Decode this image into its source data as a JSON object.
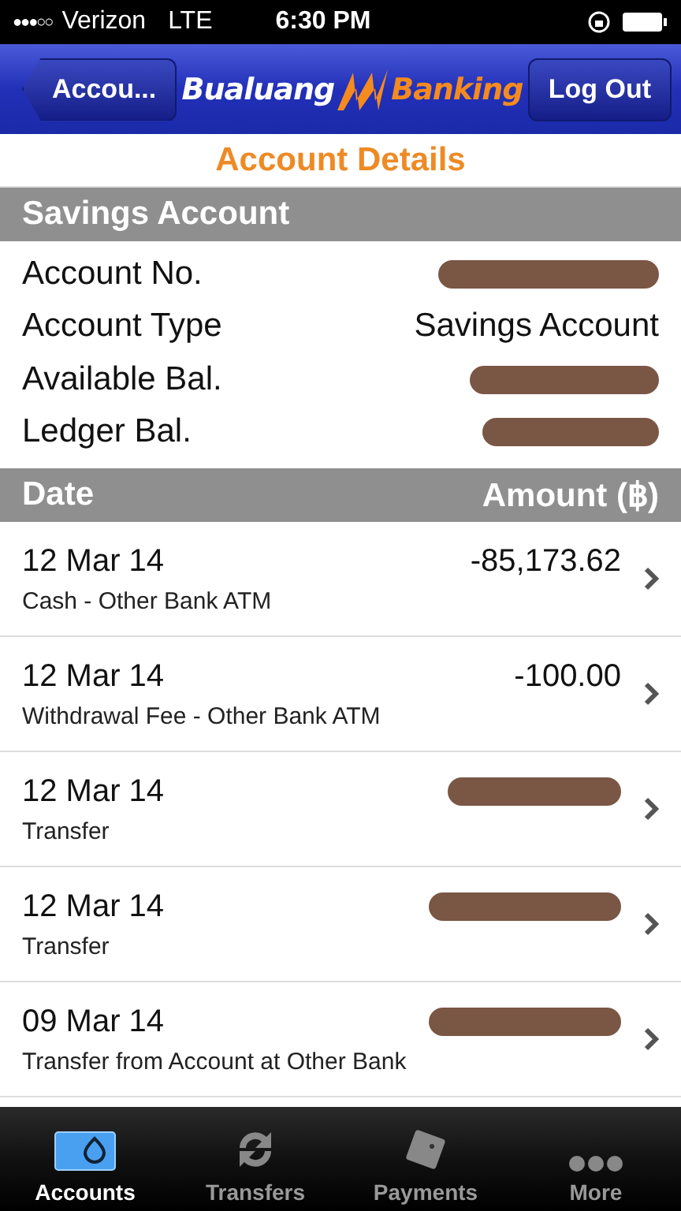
{
  "status_bar": {
    "signal_dots": [
      "●",
      "●",
      "●",
      "○",
      "○"
    ],
    "carrier": "Verizon",
    "network": "LTE",
    "time": "6:30 PM"
  },
  "nav_bar": {
    "back_button": "Accou...",
    "logo": {
      "left": "Bualuang",
      "right": "Banking"
    },
    "logout_button": "Log Out"
  },
  "page_title": "Account Details",
  "account": {
    "heading": "Savings Account",
    "fields": [
      {
        "label": "Account No.",
        "redacted": true
      },
      {
        "label": "Account Type",
        "value": "Savings Account",
        "redacted": false
      },
      {
        "label": "Available Bal.",
        "redacted": true
      },
      {
        "label": "Ledger Bal.",
        "redacted": true
      }
    ]
  },
  "transactions": {
    "columns": [
      "Date",
      "Amount (฿)"
    ],
    "rows": [
      {
        "date": "12 Mar 14",
        "description": "Cash - Other Bank ATM",
        "amount": "-85,173.62",
        "redacted": false
      },
      {
        "date": "12 Mar 14",
        "description": "Withdrawal Fee - Other Bank ATM",
        "amount": "-100.00",
        "redacted": false
      },
      {
        "date": "12 Mar 14",
        "description": "Transfer",
        "redacted": true
      },
      {
        "date": "12 Mar 14",
        "description": "Transfer",
        "redacted": true
      },
      {
        "date": "09 Mar 14",
        "description": "Transfer from Account at Other Bank",
        "redacted": true
      }
    ]
  },
  "tab_bar": [
    {
      "label": "Accounts",
      "kind": "accounts",
      "selected": true
    },
    {
      "label": "Transfers",
      "kind": "transfers",
      "selected": false
    },
    {
      "label": "Payments",
      "kind": "payments",
      "selected": false
    },
    {
      "label": "More",
      "kind": "more",
      "selected": false
    }
  ]
}
